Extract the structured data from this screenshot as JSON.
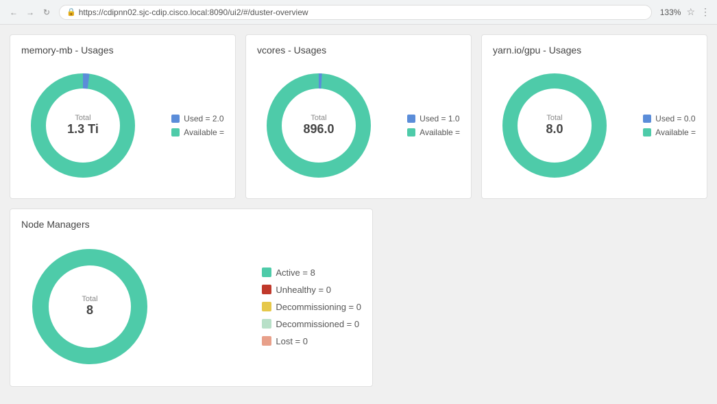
{
  "browser": {
    "url": "https://cdipnn02.sjc-cdip.cisco.local:8090/ui2/#/duster-overview",
    "zoom": "133%"
  },
  "cards": {
    "memory": {
      "title": "memory-mb - Usages",
      "total_label": "Total",
      "total_value": "1.3 Ti",
      "donut_used_pct": 2,
      "donut_avail_pct": 98,
      "legend": [
        {
          "label": "Used = 2.0",
          "color": "#5b8dd9",
          "type": "used"
        },
        {
          "label": "Available =",
          "color": "#4ecba9",
          "type": "available"
        }
      ],
      "used_color": "#5b8dd9",
      "avail_color": "#4ecba9"
    },
    "vcores": {
      "title": "vcores - Usages",
      "total_label": "Total",
      "total_value": "896.0",
      "donut_used_pct": 1,
      "donut_avail_pct": 99,
      "legend": [
        {
          "label": "Used = 1.0",
          "color": "#5b8dd9",
          "type": "used"
        },
        {
          "label": "Available =",
          "color": "#4ecba9",
          "type": "available"
        }
      ],
      "used_color": "#5b8dd9",
      "avail_color": "#4ecba9"
    },
    "gpu": {
      "title": "yarn.io/gpu - Usages",
      "total_label": "Total",
      "total_value": "8.0",
      "donut_used_pct": 0,
      "donut_avail_pct": 100,
      "legend": [
        {
          "label": "Used = 0.0",
          "color": "#5b8dd9",
          "type": "used"
        },
        {
          "label": "Available =",
          "color": "#4ecba9",
          "type": "available"
        }
      ],
      "used_color": "#5b8dd9",
      "avail_color": "#4ecba9"
    },
    "node_managers": {
      "title": "Node Managers",
      "total_label": "Total",
      "total_value": "8",
      "donut_active_pct": 100,
      "legend": [
        {
          "label": "Active = 8",
          "color": "#4ecba9",
          "type": "active"
        },
        {
          "label": "Unhealthy = 0",
          "color": "#c0392b",
          "type": "unhealthy"
        },
        {
          "label": "Decommissioning = 0",
          "color": "#e6c84a",
          "type": "decommissioning"
        },
        {
          "label": "Decommissioned = 0",
          "color": "#b8e0c8",
          "type": "decommissioned"
        },
        {
          "label": "Lost = 0",
          "color": "#e8a08a",
          "type": "lost"
        }
      ]
    }
  }
}
